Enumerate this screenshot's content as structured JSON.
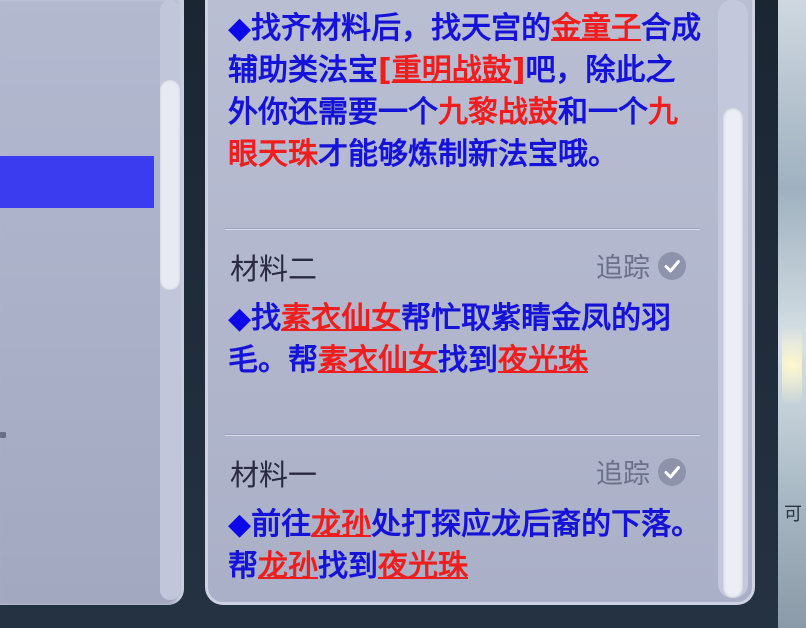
{
  "top_entry": {
    "bullet": "◆",
    "t1": "找齐材料后，找天宫的",
    "npc": "金童子",
    "t2": "合成辅助类法宝",
    "bracket_open": "[",
    "item": "重明战鼓",
    "bracket_close": "]",
    "t3": "吧，除此之外你还需要一个",
    "req1": "九黎战鼓",
    "t4": "和一个",
    "req2": "九眼天珠",
    "t5": "才能够炼制新法宝哦。"
  },
  "sections": [
    {
      "title": "材料二",
      "track_label": "追踪",
      "bullet": "◆",
      "t1": "找",
      "npc1": "素衣仙女",
      "t2": "帮忙取紫睛金凤的羽毛。帮",
      "npc2": "素衣仙女",
      "t3": "找到",
      "item": "夜光珠"
    },
    {
      "title": "材料一",
      "track_label": "追踪",
      "bullet": "◆",
      "t1": "前往",
      "npc1": "龙孙",
      "t2": "处打探应龙后裔的下落。帮",
      "npc2": "龙孙",
      "t3": "找到",
      "item": "夜光珠"
    }
  ],
  "colors": {
    "text": "#1613d8",
    "highlight": "#ef1e1e",
    "selected_row": "#3b3cf0"
  },
  "icons": [
    "check-circle-icon"
  ],
  "right_edge_text": "可"
}
